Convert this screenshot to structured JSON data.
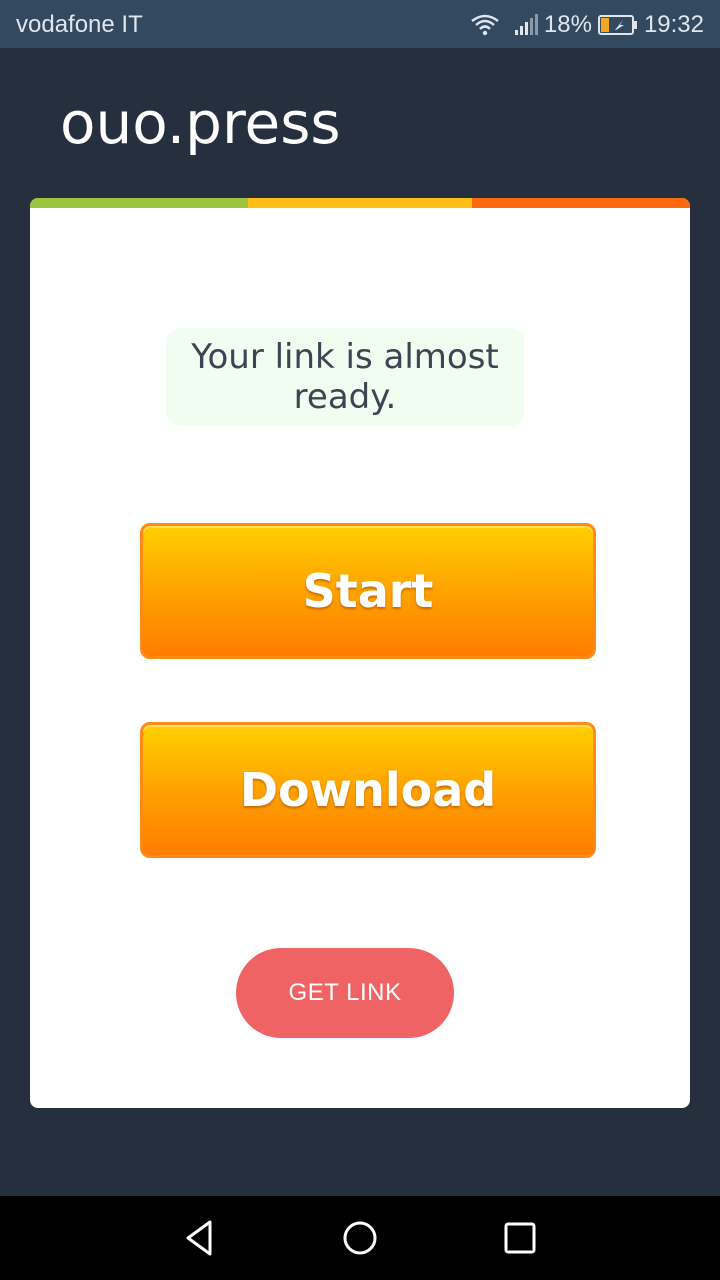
{
  "status_bar": {
    "carrier": "vodafone IT",
    "battery_percent": "18%",
    "time": "19:32",
    "icons": [
      "wifi-icon",
      "signal-icon",
      "battery-icon"
    ]
  },
  "app": {
    "title": "ouo.press"
  },
  "card": {
    "message": "Your link is almost ready.",
    "start_label": "Start",
    "download_label": "Download",
    "get_link_label": "GET LINK"
  },
  "colors": {
    "background": "#252f3e",
    "status_bar": "#334960",
    "strip_green": "#9bc53d",
    "strip_yellow": "#fdbd15",
    "strip_orange": "#fd6a0e",
    "get_link": "#f06365",
    "button_orange": "#ff9000"
  },
  "nav_bar": {
    "icons": [
      "back-icon",
      "home-icon",
      "recent-apps-icon"
    ]
  }
}
